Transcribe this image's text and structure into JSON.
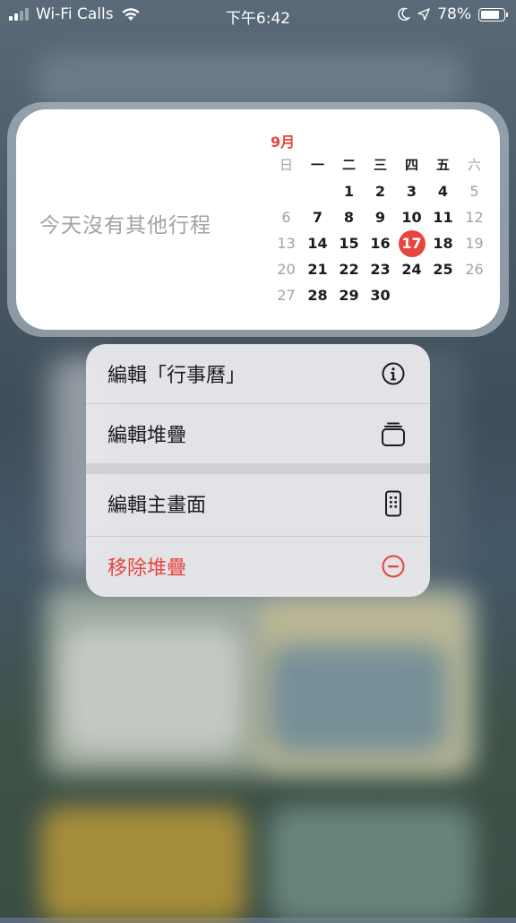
{
  "status_bar": {
    "carrier": "Wi-Fi Calls",
    "time": "下午6:42",
    "battery": "78%",
    "battery_level": 0.78
  },
  "widget": {
    "no_events_text": "今天沒有其他行程",
    "month": "9月",
    "weekdays": [
      "日",
      "一",
      "二",
      "三",
      "四",
      "五",
      "六"
    ],
    "weeks": [
      [
        "",
        "",
        "1",
        "2",
        "3",
        "4",
        "5"
      ],
      [
        "6",
        "7",
        "8",
        "9",
        "10",
        "11",
        "12"
      ],
      [
        "13",
        "14",
        "15",
        "16",
        "17",
        "18",
        "19"
      ],
      [
        "20",
        "21",
        "22",
        "23",
        "24",
        "25",
        "26"
      ],
      [
        "27",
        "28",
        "29",
        "30",
        "",
        "",
        ""
      ]
    ],
    "today": "17",
    "today_color": "#e8453c"
  },
  "menu": {
    "items": [
      {
        "label": "編輯「行事曆」",
        "icon": "info-icon"
      },
      {
        "label": "編輯堆疊",
        "icon": "stack-icon"
      },
      {
        "label": "編輯主畫面",
        "icon": "phone-icon"
      },
      {
        "label": "移除堆疊",
        "icon": "minus-circle-icon",
        "destructive": true
      }
    ],
    "destructive_color": "#e8453c"
  }
}
